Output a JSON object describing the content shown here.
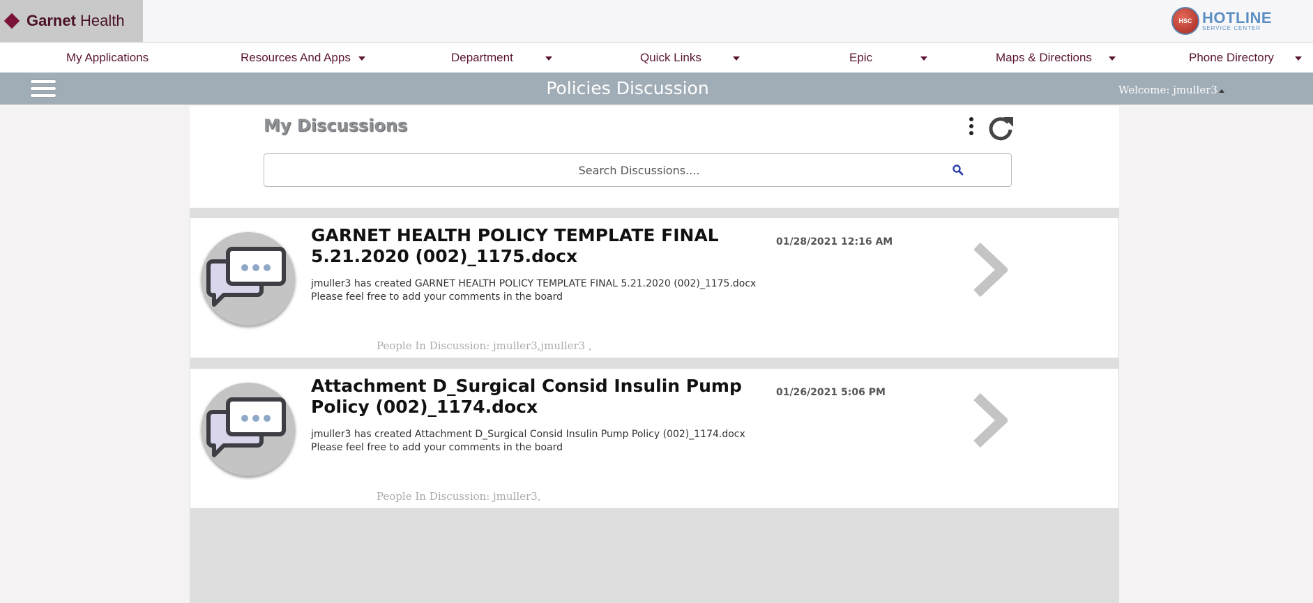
{
  "brand": {
    "name_bold": "Garnet",
    "name_light": " Health",
    "brand_color": "#7a1238"
  },
  "hotline": {
    "badge": "HSC",
    "title": "HOTLINE",
    "subtitle": "SERVICE CENTER"
  },
  "nav": {
    "items": [
      {
        "label": "My Applications",
        "has_dropdown": false
      },
      {
        "label": "Resources And Apps",
        "has_dropdown": true
      },
      {
        "label": "Department",
        "has_dropdown": true
      },
      {
        "label": "Quick Links",
        "has_dropdown": true
      },
      {
        "label": "Epic",
        "has_dropdown": true
      },
      {
        "label": "Maps & Directions",
        "has_dropdown": true
      },
      {
        "label": "Phone Directory",
        "has_dropdown": true
      }
    ]
  },
  "titlebar": {
    "title": "Policies Discussion",
    "welcome": "Welcome: jmuller3"
  },
  "discussions": {
    "heading": "My Discussions",
    "search_placeholder": "Search Discussions....",
    "items": [
      {
        "title": "GARNET HEALTH POLICY TEMPLATE FINAL 5.21.2020 (002)_1175.docx",
        "description": "jmuller3 has created GARNET HEALTH POLICY TEMPLATE FINAL 5.21.2020 (002)_1175.docx",
        "note": "Please feel free to add your comments in the board",
        "date": "01/28/2021 12:16 AM",
        "people": "People In Discussion: jmuller3,jmuller3 ,"
      },
      {
        "title": "Attachment D_Surgical Consid Insulin Pump Policy (002)_1174.docx",
        "description": "jmuller3 has created Attachment D_Surgical Consid Insulin Pump Policy (002)_1174.docx",
        "note": "Please feel free to add your comments in the board",
        "date": "01/26/2021 5:06 PM",
        "people": "People In Discussion: jmuller3,"
      }
    ]
  },
  "icons": {
    "menu": "hamburger-menu-icon",
    "more": "more-vertical-icon",
    "refresh": "refresh-icon",
    "search": "search-icon",
    "discussion": "chat-bubbles-icon",
    "open": "chevron-right-icon"
  },
  "colors": {
    "nav_text": "#5a1432",
    "titlebar_bg": "#a1adb6",
    "search_icon": "#2a3fa8",
    "chevron": "#c4c4c4"
  }
}
